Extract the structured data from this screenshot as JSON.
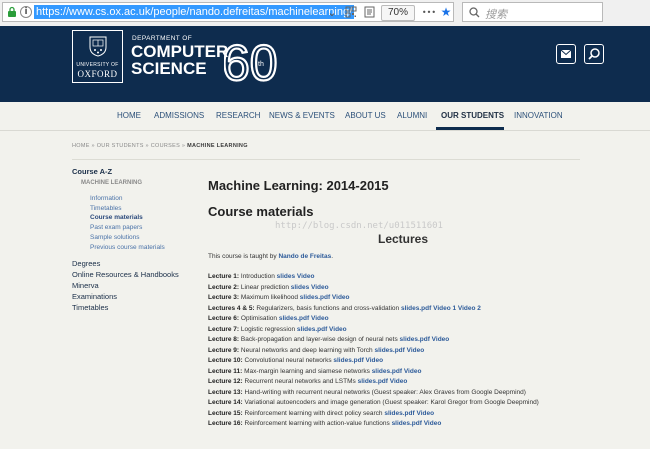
{
  "browser": {
    "url": "https://www.cs.ox.ac.uk/people/nando.defreitas/machinelearning/",
    "info_glyph": "i",
    "dropdown_glyph": "⌄",
    "zoom": "70%",
    "more_glyph": "•••",
    "star_glyph": "★",
    "search_placeholder": "搜索"
  },
  "header": {
    "university_line": "UNIVERSITY OF",
    "university_name": "OXFORD",
    "department_line": "DEPARTMENT OF",
    "title_line1": "COMPUTER",
    "title_line2": "SCIENCE",
    "anniversary": "60",
    "anniversary_suffix": "th"
  },
  "nav": {
    "items": [
      "HOME",
      "ADMISSIONS",
      "RESEARCH",
      "NEWS & EVENTS",
      "ABOUT US",
      "ALUMNI",
      "OUR STUDENTS",
      "INNOVATION"
    ],
    "active": "OUR STUDENTS"
  },
  "breadcrumb": {
    "items": [
      "HOME",
      "OUR STUDENTS",
      "COURSES"
    ],
    "separator": "»",
    "current": "MACHINE LEARNING"
  },
  "sidebar": {
    "heading": "Course A-Z",
    "subheading": "MACHINE LEARNING",
    "links": [
      "Information",
      "Timetables",
      "Course materials",
      "Past exam papers",
      "Sample solutions",
      "Previous course materials"
    ],
    "current": "Course materials",
    "main_links": [
      "Degrees",
      "Online Resources & Handbooks",
      "Minerva",
      "Examinations",
      "Timetables"
    ]
  },
  "content": {
    "title": "Machine Learning: 2014-2015",
    "subtitle": "Course materials",
    "watermark": "http://blog.csdn.net/u011511601",
    "lectures_heading": "Lectures",
    "taught_prefix": "This course is taught by ",
    "taught_name": "Nando de Freitas",
    "taught_suffix": ".",
    "lectures": [
      {
        "num": "Lecture 1:",
        "text": "Introduction",
        "links": "slides Video"
      },
      {
        "num": "Lecture 2:",
        "text": "Linear prediction",
        "links": "slides Video"
      },
      {
        "num": "Lecture 3:",
        "text": "Maximum likelihood",
        "links": "slides.pdf Video"
      },
      {
        "num": "Lectures 4 & 5:",
        "text": "Regularizers, basis functions and cross-validation",
        "links": "slides.pdf Video 1 Video 2"
      },
      {
        "num": "Lecture 6:",
        "text": "Optimisation",
        "links": "slides.pdf Video"
      },
      {
        "num": "Lecture 7:",
        "text": "Logistic regression",
        "links": "slides.pdf Video"
      },
      {
        "num": "Lecture 8:",
        "text": "Back-propagation and layer-wise design of neural nets",
        "links": "slides.pdf Video"
      },
      {
        "num": "Lecture 9:",
        "text": "Neural networks and deep learning with Torch",
        "links": "slides.pdf Video"
      },
      {
        "num": "Lecture 10:",
        "text": "Convolutional neural networks",
        "links": "slides.pdf Video"
      },
      {
        "num": "Lecture 11:",
        "text": "Max-margin learning and siamese networks",
        "links": "slides.pdf Video"
      },
      {
        "num": "Lecture 12:",
        "text": "Recurrent neural networks and LSTMs",
        "links": "slides.pdf Video"
      },
      {
        "num": "Lecture 13:",
        "text": "Hand-writing with recurrent neural networks (Guest speaker: Alex Graves from Google Deepmind)",
        "links": ""
      },
      {
        "num": "Lecture 14:",
        "text": "Variational autoencoders and image generation (Guest speaker: Karol Gregor from Google Deepmind)",
        "links": ""
      },
      {
        "num": "Lecture 15:",
        "text": "Reinforcement learning with direct policy search",
        "links": "slides.pdf Video"
      },
      {
        "num": "Lecture 16:",
        "text": "Reinforcement learning with action-value functions",
        "links": "slides.pdf Video"
      }
    ]
  },
  "colors": {
    "header_bg": "#0e2c4e",
    "body_bg": "#f2f2ed",
    "link": "#2c5a99",
    "url_highlight": "#3399ff"
  }
}
